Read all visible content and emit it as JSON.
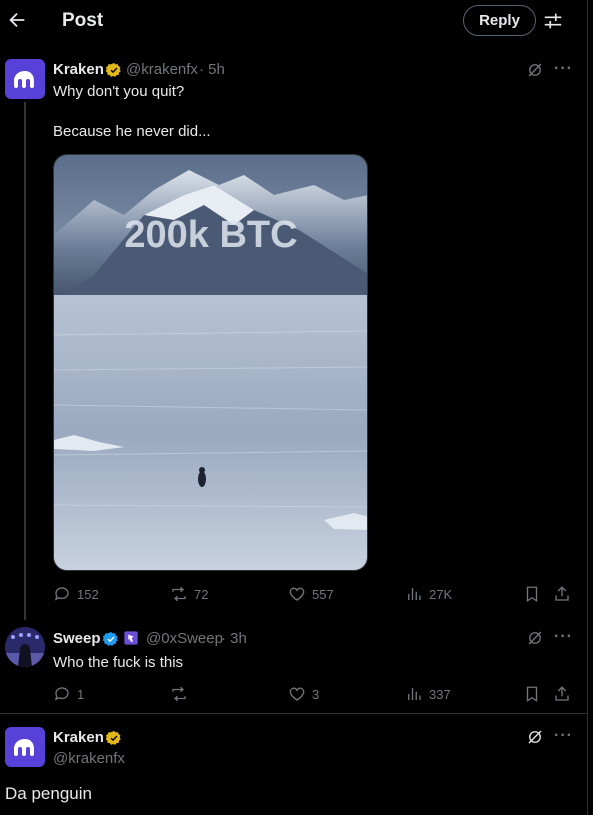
{
  "header": {
    "title": "Post",
    "reply_label": "Reply"
  },
  "posts": [
    {
      "author": "Kraken",
      "handle": "@krakenfx",
      "time": "· 5h",
      "text_line1": "Why don't you quit?",
      "text_line2": "Because he never did...",
      "media_text": "200k BTC",
      "stats": {
        "replies": "152",
        "reposts": "72",
        "likes": "557",
        "views": "27K"
      }
    },
    {
      "author": "Sweep",
      "handle": "@0xSweep",
      "time": "· 3h",
      "text": "Who the fuck is this",
      "stats": {
        "replies": "1",
        "reposts": "",
        "likes": "3",
        "views": "337"
      }
    },
    {
      "author": "Kraken",
      "handle": "@krakenfx",
      "text": "Da penguin"
    }
  ],
  "colors": {
    "background": "#000000",
    "kraken_purple": "#5741d9",
    "verified_gold": "#e2b719",
    "verified_blue": "#1d9bf0",
    "muted": "#71767b"
  }
}
